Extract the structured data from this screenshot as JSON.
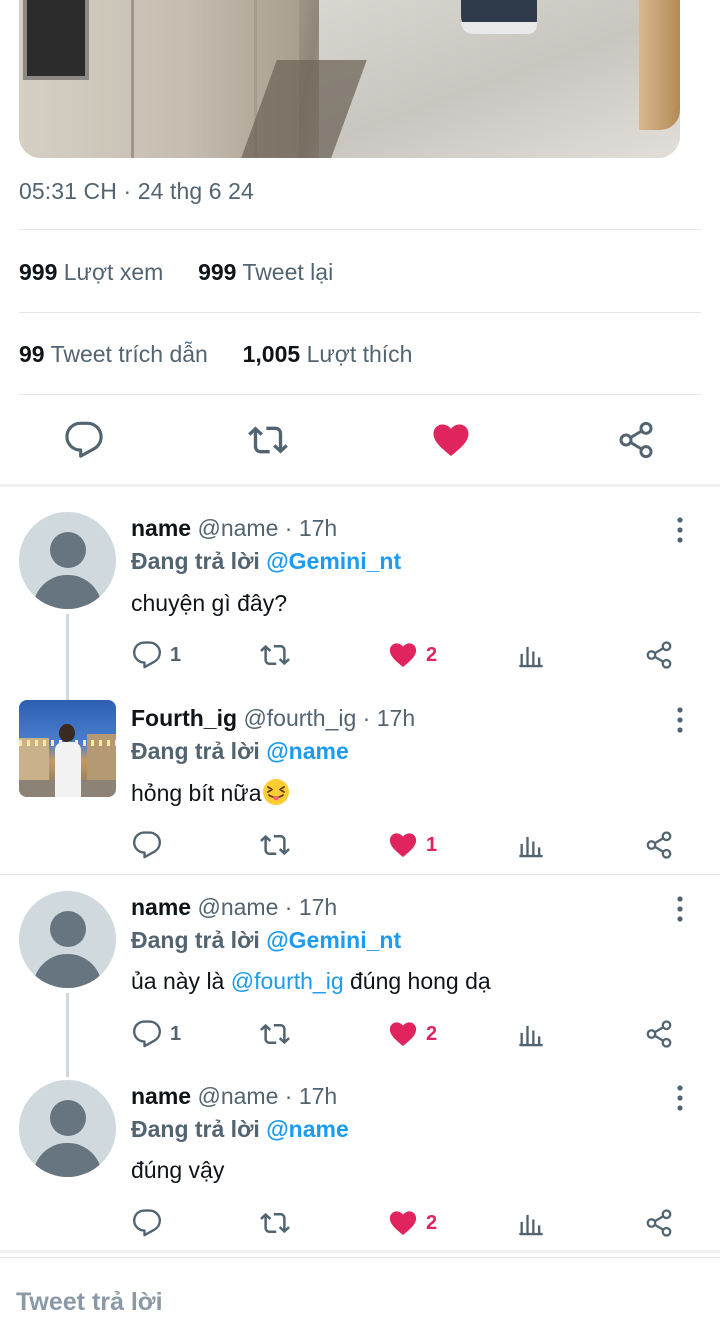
{
  "tweet": {
    "timestamp": "05:31 CH · 24 thg 6 24",
    "stats": {
      "views_count": "999",
      "views_label": "Lượt xem",
      "retweets_count": "999",
      "retweets_label": "Tweet lại",
      "quotes_count": "99",
      "quotes_label": "Tweet trích dẫn",
      "likes_count": "1,005",
      "likes_label": "Lượt thích"
    },
    "icons": [
      "reply-icon",
      "retweet-icon",
      "heart-filled-icon",
      "share-icon"
    ],
    "liked": true
  },
  "colors": {
    "accent": "#1d9bf0",
    "like": "#e0245e",
    "secondary_text": "#536471"
  },
  "replies": [
    {
      "name": "name",
      "handle": "@name",
      "time": "17h",
      "replying_prefix": "Đang trả lời",
      "replying_to": "@Gemini_nt",
      "text": "chuyện gì đây?",
      "reply_count": "1",
      "like_count": "2"
    },
    {
      "name": "Fourth_ig",
      "handle": "@fourth_ig",
      "time": "17h",
      "replying_prefix": "Đang trả lời",
      "replying_to": "@name",
      "text": "hỏng bít nữa",
      "emoji": "squinting-face-with-tongue",
      "reply_count": "",
      "like_count": "1"
    },
    {
      "name": "name",
      "handle": "@name",
      "time": "17h",
      "replying_prefix": "Đang trả lời",
      "replying_to": "@Gemini_nt",
      "text_before": "ủa này là",
      "text_mention": "@fourth_ig",
      "text_after": "đúng hong dạ",
      "reply_count": "1",
      "like_count": "2"
    },
    {
      "name": "name",
      "handle": "@name",
      "time": "17h",
      "replying_prefix": "Đang trả lời",
      "replying_to": "@name",
      "text": "đúng vậy",
      "reply_count": "",
      "like_count": "2"
    }
  ],
  "composer": {
    "placeholder": "Tweet trả lời"
  }
}
